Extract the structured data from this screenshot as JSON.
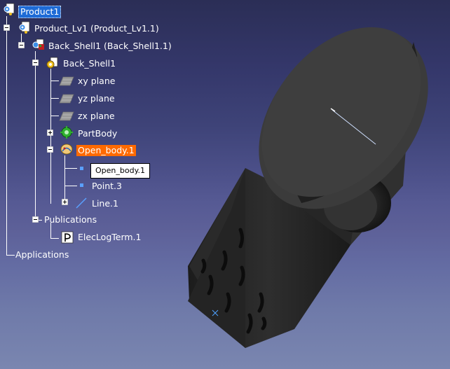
{
  "tree": {
    "product": "Product1",
    "product_lv": "Product_Lv1 (Product_Lv1.1)",
    "back_shell_instance": "Back_Shell1 (Back_Shell1.1)",
    "back_shell_part": "Back_Shell1",
    "xy_plane": "xy plane",
    "yz_plane": "yz plane",
    "zx_plane": "zx plane",
    "part_body": "PartBody",
    "open_body": "Open_body.1",
    "open_body_tooltip": "Open_body.1",
    "point": "Point.3",
    "line": "Line.1",
    "publications": "Publications",
    "elec_log_term": "ElecLogTerm.1",
    "applications": "Applications"
  },
  "colors": {
    "selection": "#1e6bd6",
    "highlight": "#ff6a00",
    "model": "#2a2a2a"
  }
}
